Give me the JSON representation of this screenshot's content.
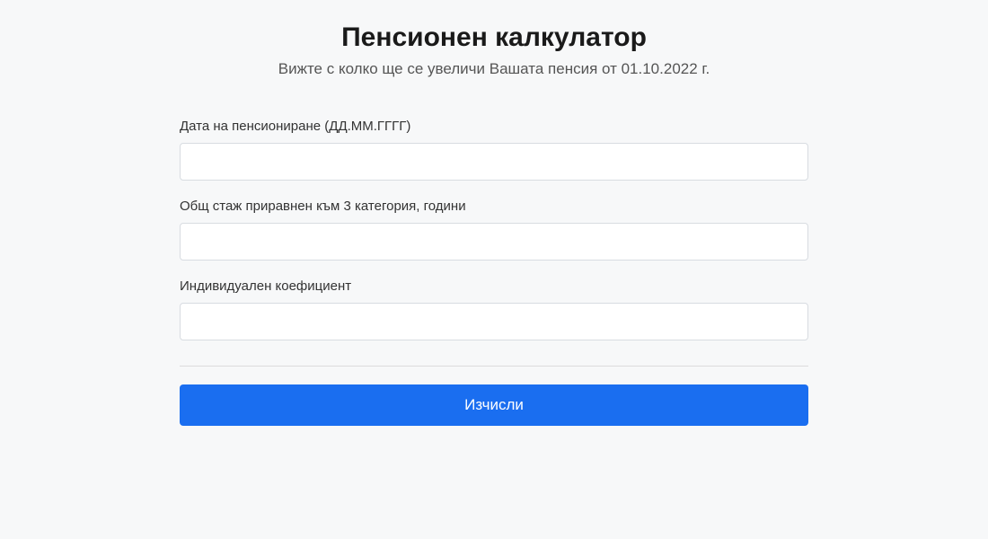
{
  "header": {
    "title": "Пенсионен калкулатор",
    "subtitle": "Вижте с колко ще се увеличи Вашата пенсия от 01.10.2022 г."
  },
  "form": {
    "fields": [
      {
        "label": "Дата на пенсиониране (ДД.ММ.ГГГГ)",
        "value": ""
      },
      {
        "label": "Общ стаж приравнен към 3 категория, години",
        "value": ""
      },
      {
        "label": "Индивидуален коефициент",
        "value": ""
      }
    ],
    "submit_label": "Изчисли"
  }
}
